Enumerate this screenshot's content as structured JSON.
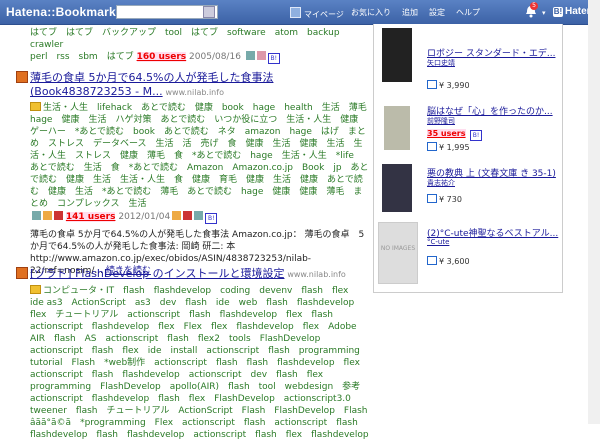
{
  "header": {
    "logo": "Hatena::Bookmark",
    "search_placeholder": "",
    "nav": [
      "マイページ",
      "お気に入り",
      "追加",
      "設定",
      "ヘルプ"
    ],
    "notification_count": "5",
    "brand": "Hatena"
  },
  "top_entry": {
    "tags": "はてブ　はてブ　バックアップ　tool　はてブ　software　atom　backup　crawler",
    "tags2": "perl　rss　sbm　はてブ",
    "users": "160 users",
    "date": "2005/08/16"
  },
  "entries": [
    {
      "title": "薄毛の食卓 5か月で64.5%の人が発毛した食事法 (Book4838723253 - M...",
      "domain": "www.nilab.info",
      "tags": "生活・人生　lifehack　あとで読む　健康　book　hage　health　生活　薄毛　hage　健康　生活　ハゲ対策　あとで読む　いつか役に立つ　生活・人生　健康　ゲーハー　*あとで読む　book　あとで読む　ネタ　amazon　hage　はげ　まとめ　ストレス　データベース　生活　活　売げ　食　健康　生活　健康　生活　生活・人生　ストレス　健康　薄毛　食　*あとで読む　hage　生活・人生　*life　あとで読む　生活　食　*あとで読む　Amazon　Amazon.co.jp　Book　jp　あとで読む　健康　生活　生活・人生　食　健康　育毛　健康　生活　健康　あとで読む　健康　生活　*あとで読む　薄毛　あとで読む　hage　健康　健康　薄毛　まとめ　コンプレックス　生活",
      "users": "141 users",
      "date": "2012/01/04",
      "desc": "薄毛の食卓 5か月で64.5%の人が発毛した食事法 Amazon.co.jp： 薄毛の食卓　5か月で64.5%の人が発毛した食事法: 岡崎 研二: 本 http://www.amazon.co.jp/exec/obidos/ASIN/4838723253/nilab-22/ref=nosim/...",
      "more": "続きを読む"
    },
    {
      "title": "[ヅラド] FlashDevelop のインストールと環境設定",
      "domain": "www.nilab.info",
      "tags": "コンピュータ・IT　flash　flashdevelop　coding　devenv　flash　flex　ide as3　ActionScript　as3　dev　flash　ide　web　flash　flashdevelop　flex　チュートリアル　actionscript　flash　flashdevelop　flex　flash　actionscript　flashdevelop　flex　Flex　flex　flashdevelop　flex　Adobe AIR　flash　AS　actionscript　flash　flex2　tools　FlashDevelop　actionscript　flash　flex　ide　install　actionscript　flash　programming　tutorial　Flash　*web制作　actionscript　flash　flash　flashdevelop　flex　actionscript　flash　flashdevelop　actionscript　dev　flash　flex　programming　FlashDevelop　apollo(AIR)　flash　tool　webdesign　参考　actionscript　flashdevelop　flash　flex　FlashDevelop　actionscript3.0　tweener　flash　チュートリアル　ActionScript　Flash　FlashDevelop　Flash　âãã°ã©ã　*programming　Flex　actionscript　flash　actionscript　flash　flashdevelop　flash　flashdevelop　actionscript　flash　flex　flashdevelop"
    }
  ],
  "sidebar": {
    "books": [
      {
        "title": "ロボジー スタンダード・エデ...",
        "author": "矢口史靖",
        "price": "¥ 3,990",
        "users": ""
      },
      {
        "title": "脳はなぜ「心」を作ったのか...",
        "author": "前野隆司",
        "price": "¥ 1,995",
        "users": "35 users"
      },
      {
        "title": "悪の教典 上 (文春文庫 き 35-1)",
        "author": "貴志祐介",
        "price": "¥ 730",
        "users": ""
      },
      {
        "title": "(2)°C-ute神聖なるベストアル...",
        "author": "°C-ute",
        "price": "¥ 3,600",
        "users": ""
      }
    ],
    "no_image": "NO IMAGES"
  }
}
